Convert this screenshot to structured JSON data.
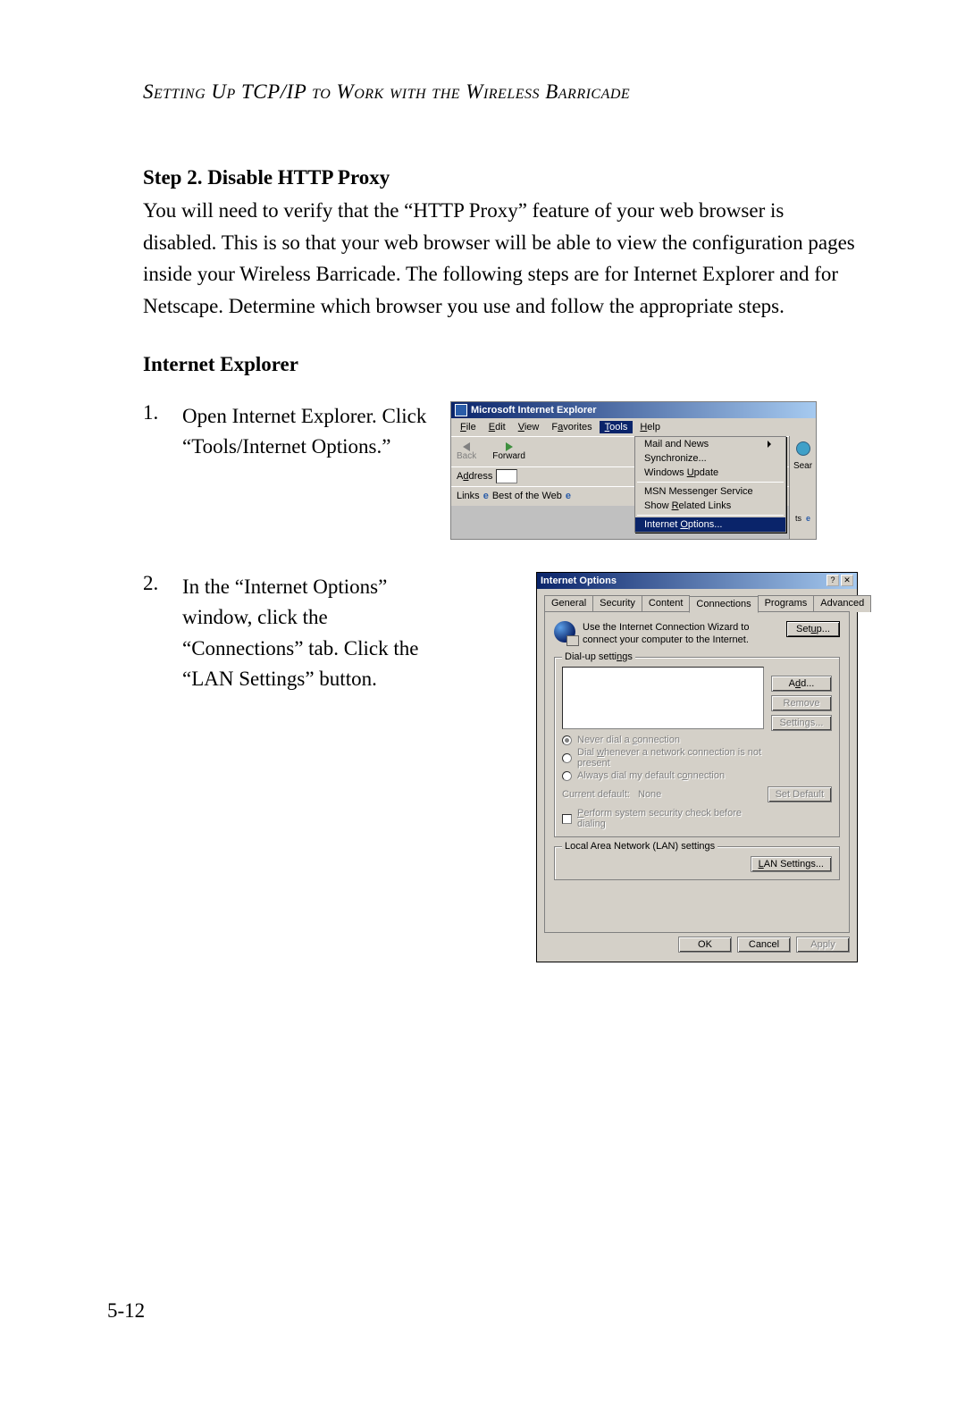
{
  "running_head": "Setting Up TCP/IP to Work with the Wireless Barricade",
  "step_title": "Step 2. Disable HTTP Proxy",
  "intro_body": "You will need to verify that the “HTTP Proxy” feature of your web browser is disabled. This is so that your web browser will be able to view the configuration pages inside your Wireless Barricade. The following steps are for Internet Explorer and for Netscape. Determine which browser you use and follow the appropriate steps.",
  "browser_heading": "Internet Explorer",
  "steps": [
    {
      "num": "1.",
      "text": "Open Internet Explorer. Click “Tools/Internet Options.”"
    },
    {
      "num": "2.",
      "text": "In the “Internet Options” window, click the “Connections” tab. Click the “LAN Settings” button."
    }
  ],
  "page_number": "5-12",
  "ie_window": {
    "title": "Microsoft Internet Explorer",
    "menus": {
      "file": "File",
      "edit": "Edit",
      "view": "View",
      "favorites": "Favorites",
      "tools": "Tools",
      "help": "Help"
    },
    "toolbar": {
      "back": "Back",
      "forward": "Forward",
      "search": "Sear"
    },
    "address_label": "Address",
    "links_label": "Links",
    "links_item": "Best of the Web",
    "tools_menu": {
      "mail_news": "Mail and News",
      "synchronize": "Synchronize...",
      "windows_update": "Windows Update",
      "msn": "MSN Messenger Service",
      "related": "Show Related Links",
      "inet_opts": "Internet Options..."
    }
  },
  "dialog": {
    "title": "Internet Options",
    "tabs": {
      "general": "General",
      "security": "Security",
      "content": "Content",
      "connections": "Connections",
      "programs": "Programs",
      "advanced": "Advanced"
    },
    "wizard_text": "Use the Internet Connection Wizard to connect your computer to the Internet.",
    "setup_btn": "Setup...",
    "dialup_legend": "Dial-up settings",
    "add_btn": "Add...",
    "remove_btn": "Remove",
    "settings_btn": "Settings...",
    "radio_never": "Never dial a connection",
    "radio_whenever": "Dial whenever a network connection is not present",
    "radio_always": "Always dial my default connection",
    "current_label": "Current default:",
    "current_value": "None",
    "set_default_btn": "Set Default",
    "security_check": "Perform system security check before dialing",
    "lan_legend": "Local Area Network (LAN) settings",
    "lan_btn": "LAN Settings...",
    "ok": "OK",
    "cancel": "Cancel",
    "apply": "Apply"
  }
}
